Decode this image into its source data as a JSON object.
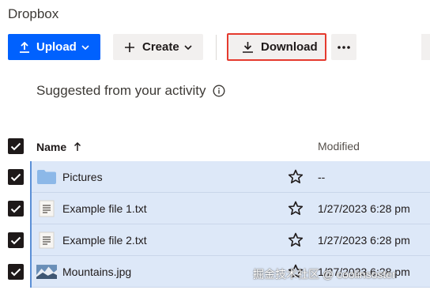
{
  "app": {
    "title": "Dropbox"
  },
  "toolbar": {
    "upload_label": "Upload",
    "create_label": "Create",
    "download_label": "Download"
  },
  "suggested": {
    "label": "Suggested from your activity"
  },
  "table": {
    "columns": {
      "name": "Name",
      "modified": "Modified"
    },
    "rows": [
      {
        "name": "Pictures",
        "type": "folder",
        "modified": "--",
        "selected": true
      },
      {
        "name": "Example file 1.txt",
        "type": "text",
        "modified": "1/27/2023 6:28 pm",
        "selected": true
      },
      {
        "name": "Example file 2.txt",
        "type": "text",
        "modified": "1/27/2023 6:28 pm",
        "selected": true
      },
      {
        "name": "Mountains.jpg",
        "type": "image",
        "modified": "1/27/2023 6:28 pm",
        "selected": true
      }
    ]
  },
  "watermark": {
    "text": "掘金技术社区 @ coolinsoster"
  },
  "colors": {
    "accent": "#0061fe",
    "highlight": "#e53a2e",
    "selection": "#dde8f8"
  }
}
